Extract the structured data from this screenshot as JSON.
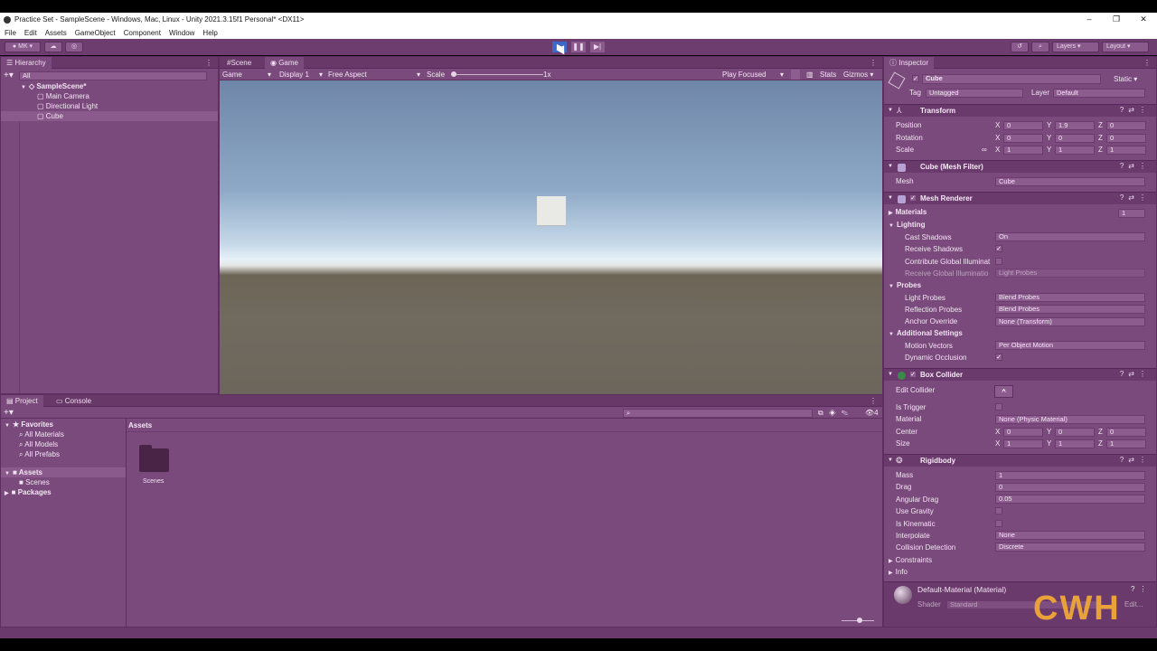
{
  "window": {
    "title": "Practice Set - SampleScene - Windows, Mac, Linux - Unity 2021.3.15f1 Personal* <DX11>",
    "controls": [
      "–",
      "❐",
      "✕"
    ]
  },
  "menu": [
    "File",
    "Edit",
    "Assets",
    "GameObject",
    "Component",
    "Window",
    "Help"
  ],
  "toolbar": {
    "account": "MK",
    "layers": "Layers",
    "layout": "Layout",
    "play": "▶",
    "pause": "❚❚",
    "step": "▶|"
  },
  "hierarchy": {
    "tab": "Hierarchy",
    "search_placeholder": "All",
    "scene": "SampleScene*",
    "items": [
      "Main Camera",
      "Directional Light",
      "Cube"
    ]
  },
  "view_tabs": [
    "Scene",
    "Game"
  ],
  "game_toolbar": {
    "display_mode": "Game",
    "display": "Display 1",
    "aspect": "Free Aspect",
    "scale_label": "Scale",
    "scale_value": "1x",
    "play_focused": "Play Focused",
    "stats": "Stats",
    "gizmos": "Gizmos"
  },
  "project": {
    "tabs": [
      "Project",
      "Console"
    ],
    "favorites_label": "Favorites",
    "favorites": [
      "All Materials",
      "All Models",
      "All Prefabs"
    ],
    "assets_label": "Assets",
    "assets_children": [
      "Scenes"
    ],
    "packages_label": "Packages",
    "breadcrumb": "Assets",
    "grid_items": [
      "Scenes"
    ],
    "hidden_count": "4"
  },
  "inspector": {
    "tab": "Inspector",
    "object_name": "Cube",
    "static_label": "Static",
    "tag_label": "Tag",
    "tag_value": "Untagged",
    "layer_label": "Layer",
    "layer_value": "Default",
    "transform": {
      "title": "Transform",
      "rows": [
        {
          "label": "Position",
          "x": "0",
          "y": "1.9",
          "z": "0"
        },
        {
          "label": "Rotation",
          "x": "0",
          "y": "0",
          "z": "0"
        },
        {
          "label": "Scale",
          "x": "1",
          "y": "1",
          "z": "1"
        }
      ]
    },
    "mesh_filter": {
      "title": "Cube (Mesh Filter)",
      "mesh_label": "Mesh",
      "mesh_value": "Cube"
    },
    "mesh_renderer": {
      "title": "Mesh Renderer",
      "materials_label": "Materials",
      "materials_count": "1",
      "lighting_label": "Lighting",
      "cast_shadows_label": "Cast Shadows",
      "cast_shadows_value": "On",
      "receive_shadows_label": "Receive Shadows",
      "contribute_gi_label": "Contribute Global Illuminat",
      "receive_gi_label": "Receive Global Illuminatio",
      "receive_gi_value": "Light Probes",
      "probes_label": "Probes",
      "light_probes_label": "Light Probes",
      "light_probes_value": "Blend Probes",
      "reflection_probes_label": "Reflection Probes",
      "reflection_probes_value": "Blend Probes",
      "anchor_override_label": "Anchor Override",
      "anchor_override_value": "None (Transform)",
      "additional_label": "Additional Settings",
      "motion_vectors_label": "Motion Vectors",
      "motion_vectors_value": "Per Object Motion",
      "dynamic_occlusion_label": "Dynamic Occlusion"
    },
    "box_collider": {
      "title": "Box Collider",
      "edit_label": "Edit Collider",
      "is_trigger_label": "Is Trigger",
      "material_label": "Material",
      "material_value": "None (Physic Material)",
      "center_label": "Center",
      "center": {
        "x": "0",
        "y": "0",
        "z": "0"
      },
      "size_label": "Size",
      "size": {
        "x": "1",
        "y": "1",
        "z": "1"
      }
    },
    "rigidbody": {
      "title": "Rigidbody",
      "mass_label": "Mass",
      "mass": "1",
      "drag_label": "Drag",
      "drag": "0",
      "angular_drag_label": "Angular Drag",
      "angular_drag": "0.05",
      "use_gravity_label": "Use Gravity",
      "is_kinematic_label": "Is Kinematic",
      "interpolate_label": "Interpolate",
      "interpolate": "None",
      "collision_label": "Collision Detection",
      "collision": "Discrete",
      "constraints_label": "Constraints",
      "info_label": "Info"
    },
    "material": {
      "name": "Default-Material (Material)",
      "shader_label": "Shader",
      "shader_value": "Standard",
      "edit_label": "Edit..."
    }
  },
  "watermark": "CWH"
}
